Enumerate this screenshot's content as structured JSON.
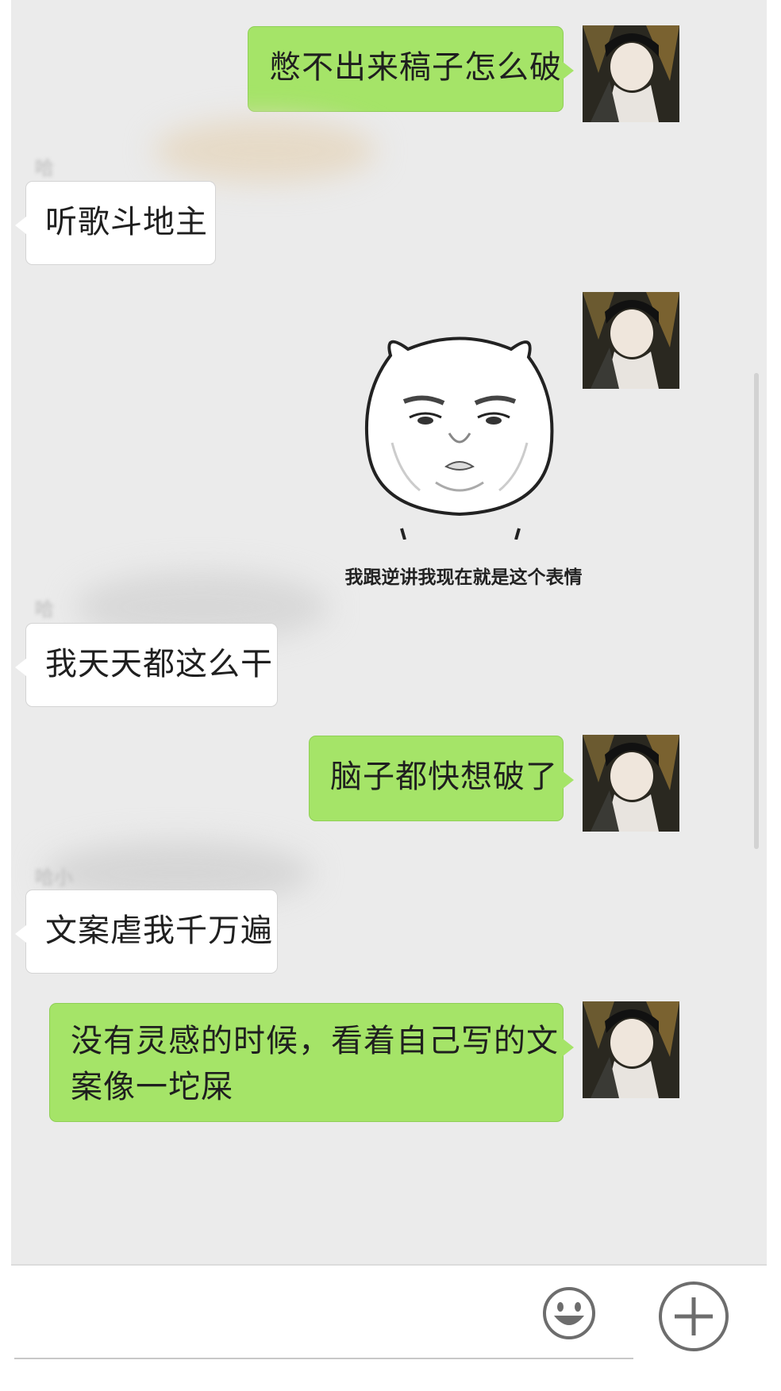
{
  "colors": {
    "chat_background": "#ebebeb",
    "outgoing_bubble": "#a5e468",
    "incoming_bubble": "#ffffff"
  },
  "messages": [
    {
      "direction": "out",
      "type": "text",
      "text": "憋不出来稿子怎么破"
    },
    {
      "direction": "in",
      "type": "text",
      "sender": "哈",
      "text": "听歌斗地主"
    },
    {
      "direction": "out",
      "type": "sticker",
      "sticker_icon": "chubby-face-sticker",
      "caption": "我跟逆讲我现在就是这个表情"
    },
    {
      "direction": "in",
      "type": "text",
      "sender": "哈",
      "text": "我天天都这么干"
    },
    {
      "direction": "out",
      "type": "text",
      "text": "脑子都快想破了"
    },
    {
      "direction": "in",
      "type": "text",
      "sender": "哈小",
      "text": "文案虐我千万遍"
    },
    {
      "direction": "out",
      "type": "text",
      "lines": [
        "没有灵感的时候，看着自己写的文",
        "案像一坨屎"
      ]
    }
  ],
  "input_bar": {
    "emoji_icon": "smiley-icon",
    "plus_icon": "plus-circle-icon"
  }
}
